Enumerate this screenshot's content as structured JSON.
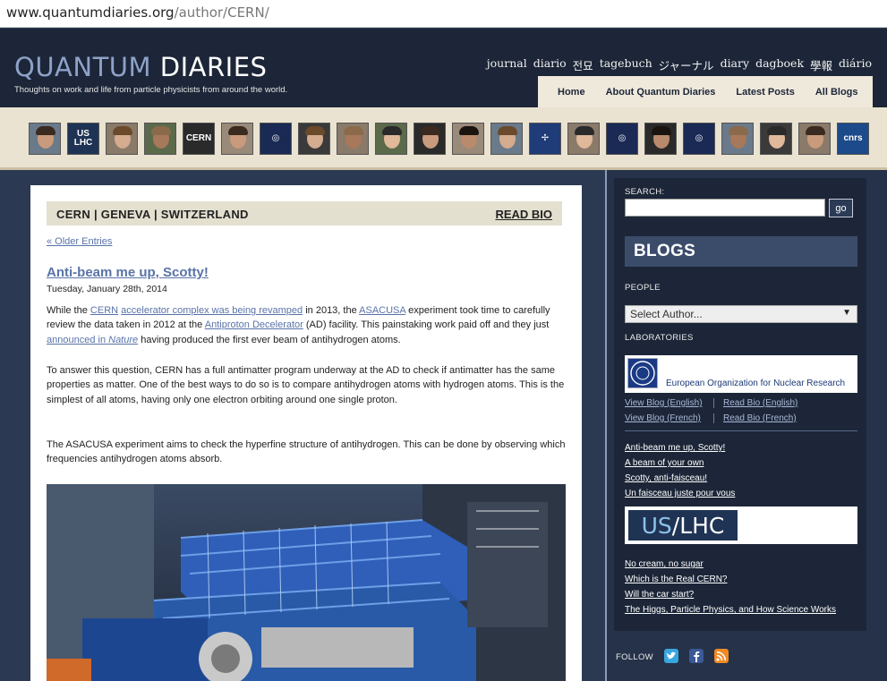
{
  "browser": {
    "url_domain": "www.quantumdiaries.org",
    "url_path": "/author/CERN/"
  },
  "header": {
    "logo_part1": "QUANTUM",
    "logo_part2": "DIARIES",
    "tagline": "Thoughts on work and life from particle physicists from around the world.",
    "languages": [
      "journal",
      "diario",
      "전묘",
      "tagebuch",
      "ジャーナル",
      "diary",
      "dagboek",
      "學報",
      "diário"
    ],
    "nav": [
      "Home",
      "About Quantum Diaries",
      "Latest Posts",
      "All Blogs"
    ]
  },
  "avatars": [
    "person",
    "US LHC",
    "person",
    "person",
    "CERN",
    "person",
    "logo",
    "person",
    "person",
    "person",
    "person",
    "person",
    "person",
    "Fermilab",
    "person",
    "logo",
    "person",
    "logo",
    "person",
    "person",
    "person",
    "cnrs"
  ],
  "bio_bar": {
    "who": "CERN | GENEVA | SWITZERLAND",
    "read_bio": "READ BIO"
  },
  "older_entries": "« Older Entries",
  "post": {
    "title": "Anti-beam me up, Scotty!",
    "date": "Tuesday, January 28th, 2014",
    "p1": {
      "t1": "While the ",
      "l1": "CERN",
      "t2": " ",
      "l2": "accelerator complex was being revamped",
      "t3": " in 2013, the ",
      "l3": "ASACUSA",
      "t4": " experiment took time to carefully review the data taken in 2012 at the ",
      "l4": "Antiproton Decelerator",
      "t5": " (AD) facility. This painstaking work paid off and they just ",
      "l5": "announced in ",
      "l5b": "Nature",
      "t6": " having produced the first ever beam of antihydrogen atoms."
    },
    "p2": "To answer this question, CERN has a full antimatter program underway at the AD to check if antimatter has the same properties as matter. One of the best ways to do so is to compare antihydrogen atoms with hydrogen atoms. This is the simplest of all atoms, having only one electron orbiting around one single proton.",
    "p3": "The ASACUSA experiment aims to check the hyperfine structure of antihydrogen. This can be done by observing which frequencies antihydrogen atoms absorb."
  },
  "sidebar": {
    "search_label": "SEARCH:",
    "search_value": "",
    "go": "go",
    "blogs_title": "BLOGS",
    "people_label": "PEOPLE",
    "people_select": "Select Author...",
    "labs_label": "LABORATORIES",
    "cern_name": "European Organization for Nuclear Research",
    "cern_logo": "CERN",
    "links": {
      "view_en": "View Blog (English)",
      "read_en": "Read Bio (English)",
      "view_fr": "View Blog (French)",
      "read_fr": "Read Bio (French)"
    },
    "cern_posts": [
      "Anti-beam me up, Scotty!",
      "A beam of your own",
      "Scotty, anti-faisceau!",
      "Un faisceau juste pour vous"
    ],
    "uslhc_us": "US",
    "uslhc_slash": "/",
    "uslhc_lhc": "LHC",
    "uslhc_posts": [
      "No cream, no sugar",
      "Which is the Real CERN?",
      "Will the car start?",
      "The Higgs, Particle Physics, and How Science Works"
    ],
    "follow": "FOLLOW",
    "social": [
      "twitter-icon",
      "facebook-icon",
      "rss-icon"
    ]
  },
  "colors": {
    "header_bg": "#1c2638",
    "page_bg": "#2b3a52",
    "link": "#5973a8",
    "cream": "#ebe3d2"
  }
}
